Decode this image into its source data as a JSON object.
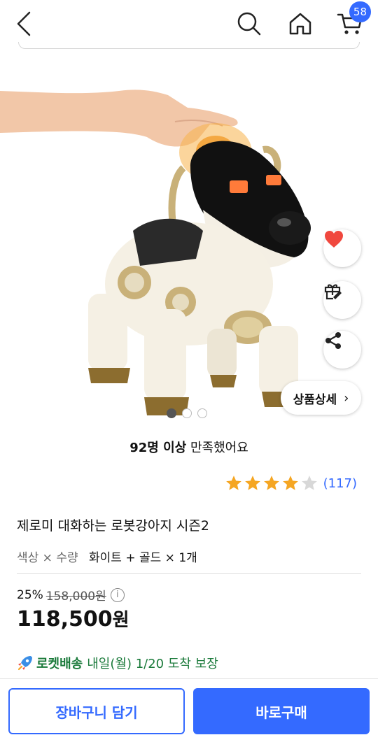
{
  "header": {
    "cart_count": "58",
    "icons": [
      "back-arrow-icon",
      "search-icon",
      "home-icon",
      "cart-icon"
    ]
  },
  "gallery": {
    "image": "robot-dog-product-photo",
    "detail_button_label": "상품상세",
    "slide_count": 3,
    "active_slide": 1,
    "icons": [
      "heart-icon",
      "gift-icon",
      "share-icon"
    ]
  },
  "product": {
    "satisfaction_bold": "92명 이상",
    "satisfaction_rest": " 만족했어요",
    "rating": 4,
    "rating_max": 5,
    "review_count": "(117)",
    "title": "제로미 대화하는 로봇강아지 시즌2",
    "option_label": "색상 × 수량",
    "option_value": "화이트 + 골드 × 1개"
  },
  "price": {
    "discount": "25%",
    "original": "158,000원",
    "sale_number": "118,500",
    "sale_unit": "원"
  },
  "delivery": {
    "label": "로켓배송",
    "text": "내일(월) 1/20 도착 보장"
  },
  "actions": {
    "cart_label": "장바구니 담기",
    "buy_label": "바로구매"
  },
  "colors": {
    "accent": "#346aff",
    "rocket_green": "#1a7a3a",
    "star": "#f5a623",
    "heart": "#f0483e"
  }
}
